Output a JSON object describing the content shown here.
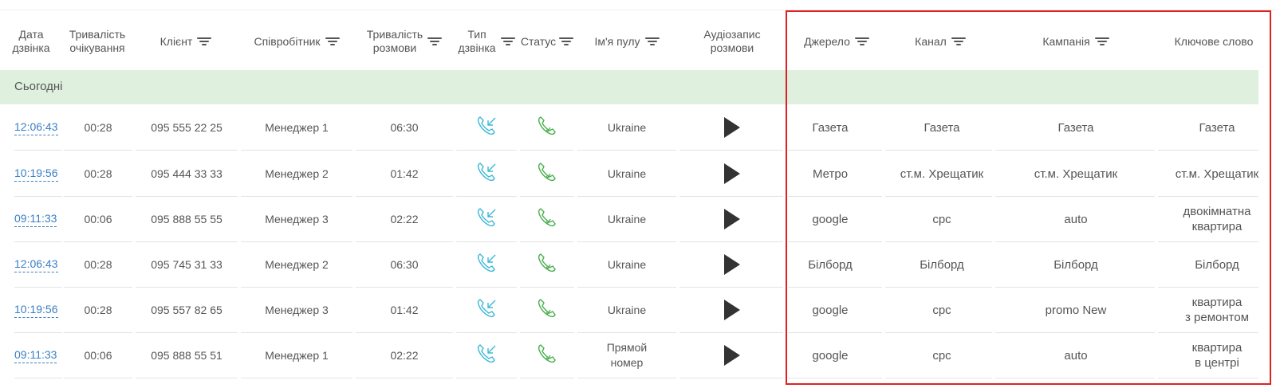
{
  "columns": {
    "date": "Дата\nдзвінка",
    "wait": "Тривалість\nочікування",
    "client": "Клієнт",
    "employee": "Співробітник",
    "talk": "Тривалість\nрозмови",
    "type": "Тип\nдзвінка",
    "status": "Статус",
    "pool": "Ім'я пулу",
    "audio": "Аудіозапис\nрозмови",
    "source": "Джерело",
    "channel": "Канал",
    "campaign": "Кампанія",
    "keyword": "Ключове слово"
  },
  "group_label": "Сьогодні",
  "accent": "#3a7fc4",
  "highlight_color": "#e02020",
  "rows": [
    {
      "time": "12:06:43",
      "wait": "00:28",
      "client": "095 555 22 25",
      "employee": "Менеджер 1",
      "talk": "06:30",
      "pool": "Ukraine",
      "source": "Газета",
      "channel": "Газета",
      "campaign": "Газета",
      "keyword": "Газета"
    },
    {
      "time": "10:19:56",
      "wait": "00:28",
      "client": "095 444 33 33",
      "employee": "Менеджер 2",
      "talk": "01:42",
      "pool": "Ukraine",
      "source": "Метро",
      "channel": "ст.м. Хрещатик",
      "campaign": "ст.м. Хрещатик",
      "keyword": "ст.м. Хрещатик"
    },
    {
      "time": "09:11:33",
      "wait": "00:06",
      "client": "095 888 55 55",
      "employee": "Менеджер 3",
      "talk": "02:22",
      "pool": "Ukraine",
      "source": "google",
      "channel": "cpc",
      "campaign": "auto",
      "keyword": "двокімнатна\nквартира"
    },
    {
      "time": "12:06:43",
      "wait": "00:28",
      "client": "095 745 31 33",
      "employee": "Менеджер 2",
      "talk": "06:30",
      "pool": "Ukraine",
      "source": "Білборд",
      "channel": "Білборд",
      "campaign": "Білборд",
      "keyword": "Білборд"
    },
    {
      "time": "10:19:56",
      "wait": "00:28",
      "client": "095 557 82 65",
      "employee": "Менеджер 3",
      "talk": "01:42",
      "pool": "Ukraine",
      "source": "google",
      "channel": "cpc",
      "campaign": "promo New",
      "keyword": "квартира\nз ремонтом"
    },
    {
      "time": "09:11:33",
      "wait": "00:06",
      "client": "095 888 55 51",
      "employee": "Менеджер 1",
      "talk": "02:22",
      "pool": "Прямой\nномер",
      "source": "google",
      "channel": "cpc",
      "campaign": "auto",
      "keyword": "квартира\nв центрі"
    }
  ],
  "icons": {
    "type": "incoming-call-icon",
    "status": "answered-call-icon",
    "audio": "play-icon",
    "filter": "filter-icon"
  }
}
